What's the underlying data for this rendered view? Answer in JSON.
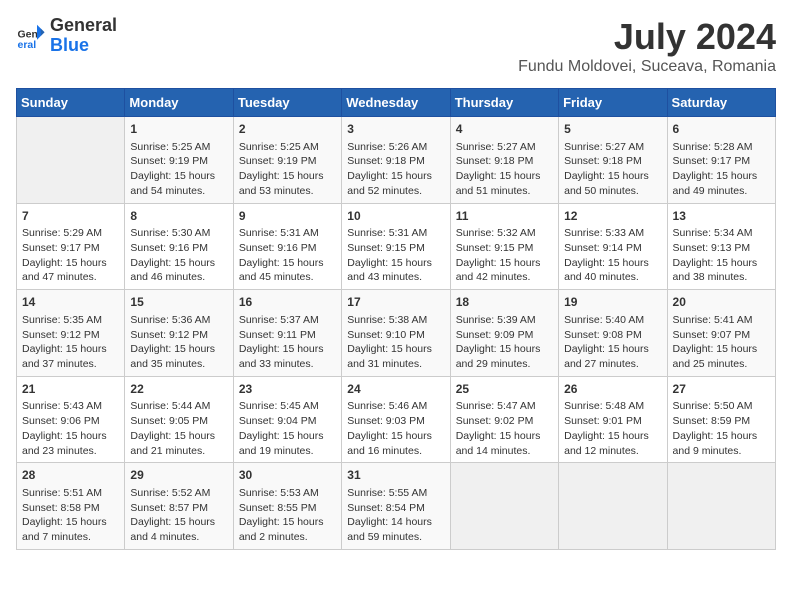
{
  "header": {
    "logo_general": "General",
    "logo_blue": "Blue",
    "month_year": "July 2024",
    "location": "Fundu Moldovei, Suceava, Romania"
  },
  "weekdays": [
    "Sunday",
    "Monday",
    "Tuesday",
    "Wednesday",
    "Thursday",
    "Friday",
    "Saturday"
  ],
  "weeks": [
    [
      {
        "day": "",
        "info": ""
      },
      {
        "day": "1",
        "info": "Sunrise: 5:25 AM\nSunset: 9:19 PM\nDaylight: 15 hours\nand 54 minutes."
      },
      {
        "day": "2",
        "info": "Sunrise: 5:25 AM\nSunset: 9:19 PM\nDaylight: 15 hours\nand 53 minutes."
      },
      {
        "day": "3",
        "info": "Sunrise: 5:26 AM\nSunset: 9:18 PM\nDaylight: 15 hours\nand 52 minutes."
      },
      {
        "day": "4",
        "info": "Sunrise: 5:27 AM\nSunset: 9:18 PM\nDaylight: 15 hours\nand 51 minutes."
      },
      {
        "day": "5",
        "info": "Sunrise: 5:27 AM\nSunset: 9:18 PM\nDaylight: 15 hours\nand 50 minutes."
      },
      {
        "day": "6",
        "info": "Sunrise: 5:28 AM\nSunset: 9:17 PM\nDaylight: 15 hours\nand 49 minutes."
      }
    ],
    [
      {
        "day": "7",
        "info": "Sunrise: 5:29 AM\nSunset: 9:17 PM\nDaylight: 15 hours\nand 47 minutes."
      },
      {
        "day": "8",
        "info": "Sunrise: 5:30 AM\nSunset: 9:16 PM\nDaylight: 15 hours\nand 46 minutes."
      },
      {
        "day": "9",
        "info": "Sunrise: 5:31 AM\nSunset: 9:16 PM\nDaylight: 15 hours\nand 45 minutes."
      },
      {
        "day": "10",
        "info": "Sunrise: 5:31 AM\nSunset: 9:15 PM\nDaylight: 15 hours\nand 43 minutes."
      },
      {
        "day": "11",
        "info": "Sunrise: 5:32 AM\nSunset: 9:15 PM\nDaylight: 15 hours\nand 42 minutes."
      },
      {
        "day": "12",
        "info": "Sunrise: 5:33 AM\nSunset: 9:14 PM\nDaylight: 15 hours\nand 40 minutes."
      },
      {
        "day": "13",
        "info": "Sunrise: 5:34 AM\nSunset: 9:13 PM\nDaylight: 15 hours\nand 38 minutes."
      }
    ],
    [
      {
        "day": "14",
        "info": "Sunrise: 5:35 AM\nSunset: 9:12 PM\nDaylight: 15 hours\nand 37 minutes."
      },
      {
        "day": "15",
        "info": "Sunrise: 5:36 AM\nSunset: 9:12 PM\nDaylight: 15 hours\nand 35 minutes."
      },
      {
        "day": "16",
        "info": "Sunrise: 5:37 AM\nSunset: 9:11 PM\nDaylight: 15 hours\nand 33 minutes."
      },
      {
        "day": "17",
        "info": "Sunrise: 5:38 AM\nSunset: 9:10 PM\nDaylight: 15 hours\nand 31 minutes."
      },
      {
        "day": "18",
        "info": "Sunrise: 5:39 AM\nSunset: 9:09 PM\nDaylight: 15 hours\nand 29 minutes."
      },
      {
        "day": "19",
        "info": "Sunrise: 5:40 AM\nSunset: 9:08 PM\nDaylight: 15 hours\nand 27 minutes."
      },
      {
        "day": "20",
        "info": "Sunrise: 5:41 AM\nSunset: 9:07 PM\nDaylight: 15 hours\nand 25 minutes."
      }
    ],
    [
      {
        "day": "21",
        "info": "Sunrise: 5:43 AM\nSunset: 9:06 PM\nDaylight: 15 hours\nand 23 minutes."
      },
      {
        "day": "22",
        "info": "Sunrise: 5:44 AM\nSunset: 9:05 PM\nDaylight: 15 hours\nand 21 minutes."
      },
      {
        "day": "23",
        "info": "Sunrise: 5:45 AM\nSunset: 9:04 PM\nDaylight: 15 hours\nand 19 minutes."
      },
      {
        "day": "24",
        "info": "Sunrise: 5:46 AM\nSunset: 9:03 PM\nDaylight: 15 hours\nand 16 minutes."
      },
      {
        "day": "25",
        "info": "Sunrise: 5:47 AM\nSunset: 9:02 PM\nDaylight: 15 hours\nand 14 minutes."
      },
      {
        "day": "26",
        "info": "Sunrise: 5:48 AM\nSunset: 9:01 PM\nDaylight: 15 hours\nand 12 minutes."
      },
      {
        "day": "27",
        "info": "Sunrise: 5:50 AM\nSunset: 8:59 PM\nDaylight: 15 hours\nand 9 minutes."
      }
    ],
    [
      {
        "day": "28",
        "info": "Sunrise: 5:51 AM\nSunset: 8:58 PM\nDaylight: 15 hours\nand 7 minutes."
      },
      {
        "day": "29",
        "info": "Sunrise: 5:52 AM\nSunset: 8:57 PM\nDaylight: 15 hours\nand 4 minutes."
      },
      {
        "day": "30",
        "info": "Sunrise: 5:53 AM\nSunset: 8:55 PM\nDaylight: 15 hours\nand 2 minutes."
      },
      {
        "day": "31",
        "info": "Sunrise: 5:55 AM\nSunset: 8:54 PM\nDaylight: 14 hours\nand 59 minutes."
      },
      {
        "day": "",
        "info": ""
      },
      {
        "day": "",
        "info": ""
      },
      {
        "day": "",
        "info": ""
      }
    ]
  ]
}
